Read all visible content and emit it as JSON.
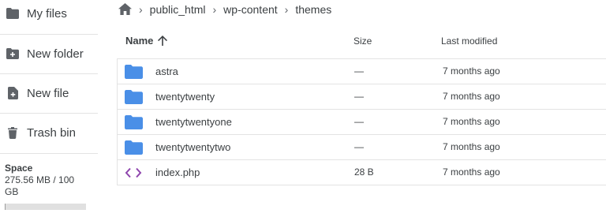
{
  "sidebar": {
    "items": [
      {
        "label": "My files",
        "icon": "folder-icon"
      },
      {
        "label": "New folder",
        "icon": "new-folder-icon"
      },
      {
        "label": "New file",
        "icon": "new-file-icon"
      },
      {
        "label": "Trash bin",
        "icon": "trash-icon"
      }
    ],
    "space": {
      "title": "Space",
      "value": "275.56 MB / 100 GB",
      "used_fraction": 0.003
    }
  },
  "breadcrumb": {
    "home_icon": "home-icon",
    "items": [
      "public_html",
      "wp-content",
      "themes"
    ],
    "separator": "›"
  },
  "file_list": {
    "columns": {
      "name": "Name",
      "size": "Size",
      "modified": "Last modified"
    },
    "sort_icon": "arrow-up-icon",
    "rows": [
      {
        "name": "astra",
        "type": "folder",
        "size": "—",
        "modified": "7 months ago"
      },
      {
        "name": "twentytwenty",
        "type": "folder",
        "size": "—",
        "modified": "7 months ago"
      },
      {
        "name": "twentytwentyone",
        "type": "folder",
        "size": "—",
        "modified": "7 months ago"
      },
      {
        "name": "twentytwentytwo",
        "type": "folder",
        "size": "—",
        "modified": "7 months ago"
      },
      {
        "name": "index.php",
        "type": "code",
        "size": "28 B",
        "modified": "7 months ago"
      }
    ]
  },
  "colors": {
    "folder": "#4a8fe7",
    "code": "#8e44ad",
    "icon_gray": "#5f6368"
  }
}
